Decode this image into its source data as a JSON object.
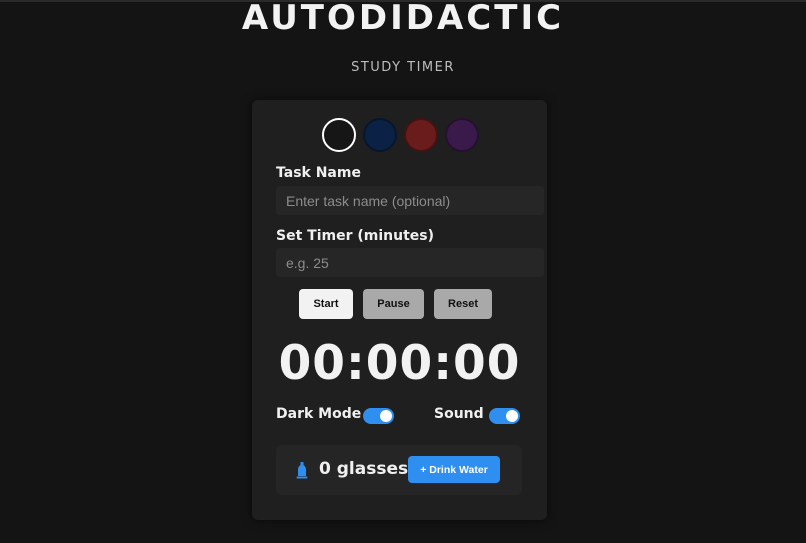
{
  "app": {
    "title": "AUTODIDACTIC",
    "subtitle": "STUDY TIMER"
  },
  "theme_swatches": [
    {
      "name": "black",
      "color": "#161616",
      "selected": true
    },
    {
      "name": "navy",
      "color": "#0b2246",
      "selected": false
    },
    {
      "name": "red",
      "color": "#6a1c1c",
      "selected": false
    },
    {
      "name": "purple",
      "color": "#3a1a4a",
      "selected": false
    }
  ],
  "task": {
    "label": "Task Name",
    "placeholder": "Enter task name (optional)",
    "value": ""
  },
  "timer_input": {
    "label": "Set Timer (minutes)",
    "placeholder": "e.g. 25",
    "value": ""
  },
  "controls": {
    "start_label": "Start",
    "pause_label": "Pause",
    "reset_label": "Reset"
  },
  "timer": {
    "display": "00:00:00"
  },
  "toggles": {
    "dark_mode_label": "Dark Mode",
    "dark_mode_on": true,
    "sound_label": "Sound",
    "sound_on": true
  },
  "water": {
    "icon": "water-bottle-icon",
    "count_text": "0 glasses",
    "button_label": "+ Drink Water"
  },
  "colors": {
    "accent": "#2f8ff0",
    "start_button": "#f2f2f2",
    "secondary_button": "#a9a9a9"
  }
}
